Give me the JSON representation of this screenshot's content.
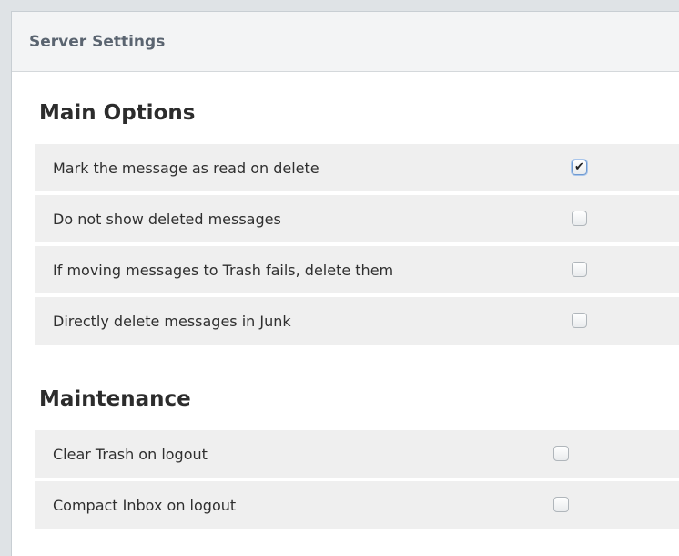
{
  "panel": {
    "title": "Server Settings"
  },
  "main_options": {
    "title": "Main Options",
    "items": [
      {
        "label": "Mark the message as read on delete",
        "checked": true
      },
      {
        "label": "Do not show deleted messages",
        "checked": false
      },
      {
        "label": "If moving messages to Trash fails, delete them",
        "checked": false
      },
      {
        "label": "Directly delete messages in Junk",
        "checked": false
      }
    ]
  },
  "maintenance": {
    "title": "Maintenance",
    "items": [
      {
        "label": "Clear Trash on logout",
        "checked": false
      },
      {
        "label": "Compact Inbox on logout",
        "checked": false
      }
    ]
  },
  "icons": {
    "checkmark": "checkmark-icon"
  },
  "colors": {
    "row_background": "#efefef",
    "header_background": "#f3f4f5",
    "checkbox_focus": "#6f9ad1"
  }
}
